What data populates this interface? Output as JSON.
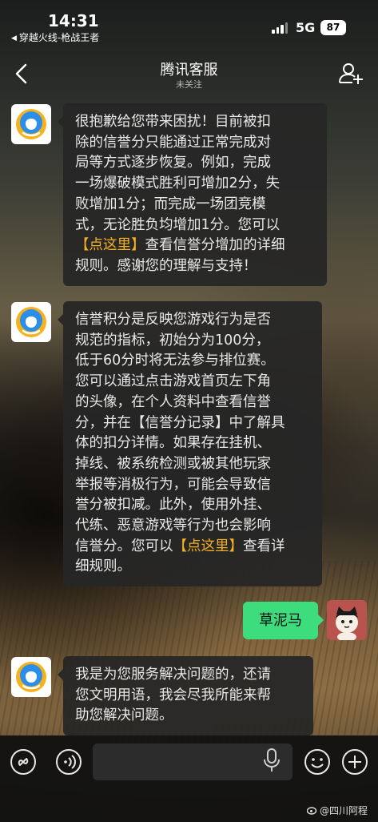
{
  "status_bar": {
    "time": "14:31",
    "back_to_app": "穿越火线-枪战王者",
    "network": "5G",
    "battery": "87"
  },
  "header": {
    "title": "腾讯客服",
    "subtitle": "未关注"
  },
  "messages": [
    {
      "sender": "腾讯客服",
      "lines": [
        [
          {
            "t": "很抱歉给您带来困扰！目前被扣"
          }
        ],
        [
          {
            "t": "除的信誉分只能通过正常完成对"
          }
        ],
        [
          {
            "t": "局等方式逐步恢复。例如，完成"
          }
        ],
        [
          {
            "t": "一场爆破模式胜利可增加2分，失"
          }
        ],
        [
          {
            "t": "败增加1分；而完成一场团竞模"
          }
        ],
        [
          {
            "t": "式，无论胜负均增加1分。您可以"
          }
        ],
        [
          {
            "t": "【点这里】",
            "link": true
          },
          {
            "t": "查看信誉分增加的详细"
          }
        ],
        [
          {
            "t": "规则。感谢您的理解与支持！"
          }
        ]
      ]
    },
    {
      "sender": "腾讯客服",
      "lines": [
        [
          {
            "t": "信誉积分是反映您游戏行为是否"
          }
        ],
        [
          {
            "t": "规范的指标，初始分为100分，"
          }
        ],
        [
          {
            "t": "低于60分时将无法参与排位赛。"
          }
        ],
        [
          {
            "t": "您可以通过点击游戏首页左下角"
          }
        ],
        [
          {
            "t": "的头像，在个人资料中查看信誉"
          }
        ],
        [
          {
            "t": "分，并在【信誉分记录】中了解具"
          }
        ],
        [
          {
            "t": "体的扣分详情。如果存在挂机、"
          }
        ],
        [
          {
            "t": "掉线、被系统检测或被其他玩家"
          }
        ],
        [
          {
            "t": "举报等消极行为，可能会导致信"
          }
        ],
        [
          {
            "t": "誉分被扣减。此外，使用外挂、"
          }
        ],
        [
          {
            "t": "代练、恶意游戏等行为也会影响"
          }
        ],
        [
          {
            "t": "信誉分。您可以"
          },
          {
            "t": "【点这里】",
            "link": true
          },
          {
            "t": "查看详"
          }
        ],
        [
          {
            "t": "细规则。"
          }
        ]
      ]
    },
    {
      "sender": "me",
      "text": "草泥马"
    },
    {
      "sender": "腾讯客服",
      "lines": [
        [
          {
            "t": "我是为您服务解决问题的，还请"
          }
        ],
        [
          {
            "t": "您文明用语，我会尽我所能来帮"
          }
        ],
        [
          {
            "t": "助您解决问题。"
          }
        ]
      ]
    }
  ],
  "input_bar": {
    "left_icons": [
      "link-icon",
      "voice-icon"
    ],
    "right_icons": [
      "emoji-icon",
      "plus-icon"
    ],
    "input_value": ""
  },
  "watermark": "@四川阿程",
  "colors": {
    "link": "#f5b025",
    "my_bubble": "#3ddc7c",
    "bubble": "#262626"
  }
}
